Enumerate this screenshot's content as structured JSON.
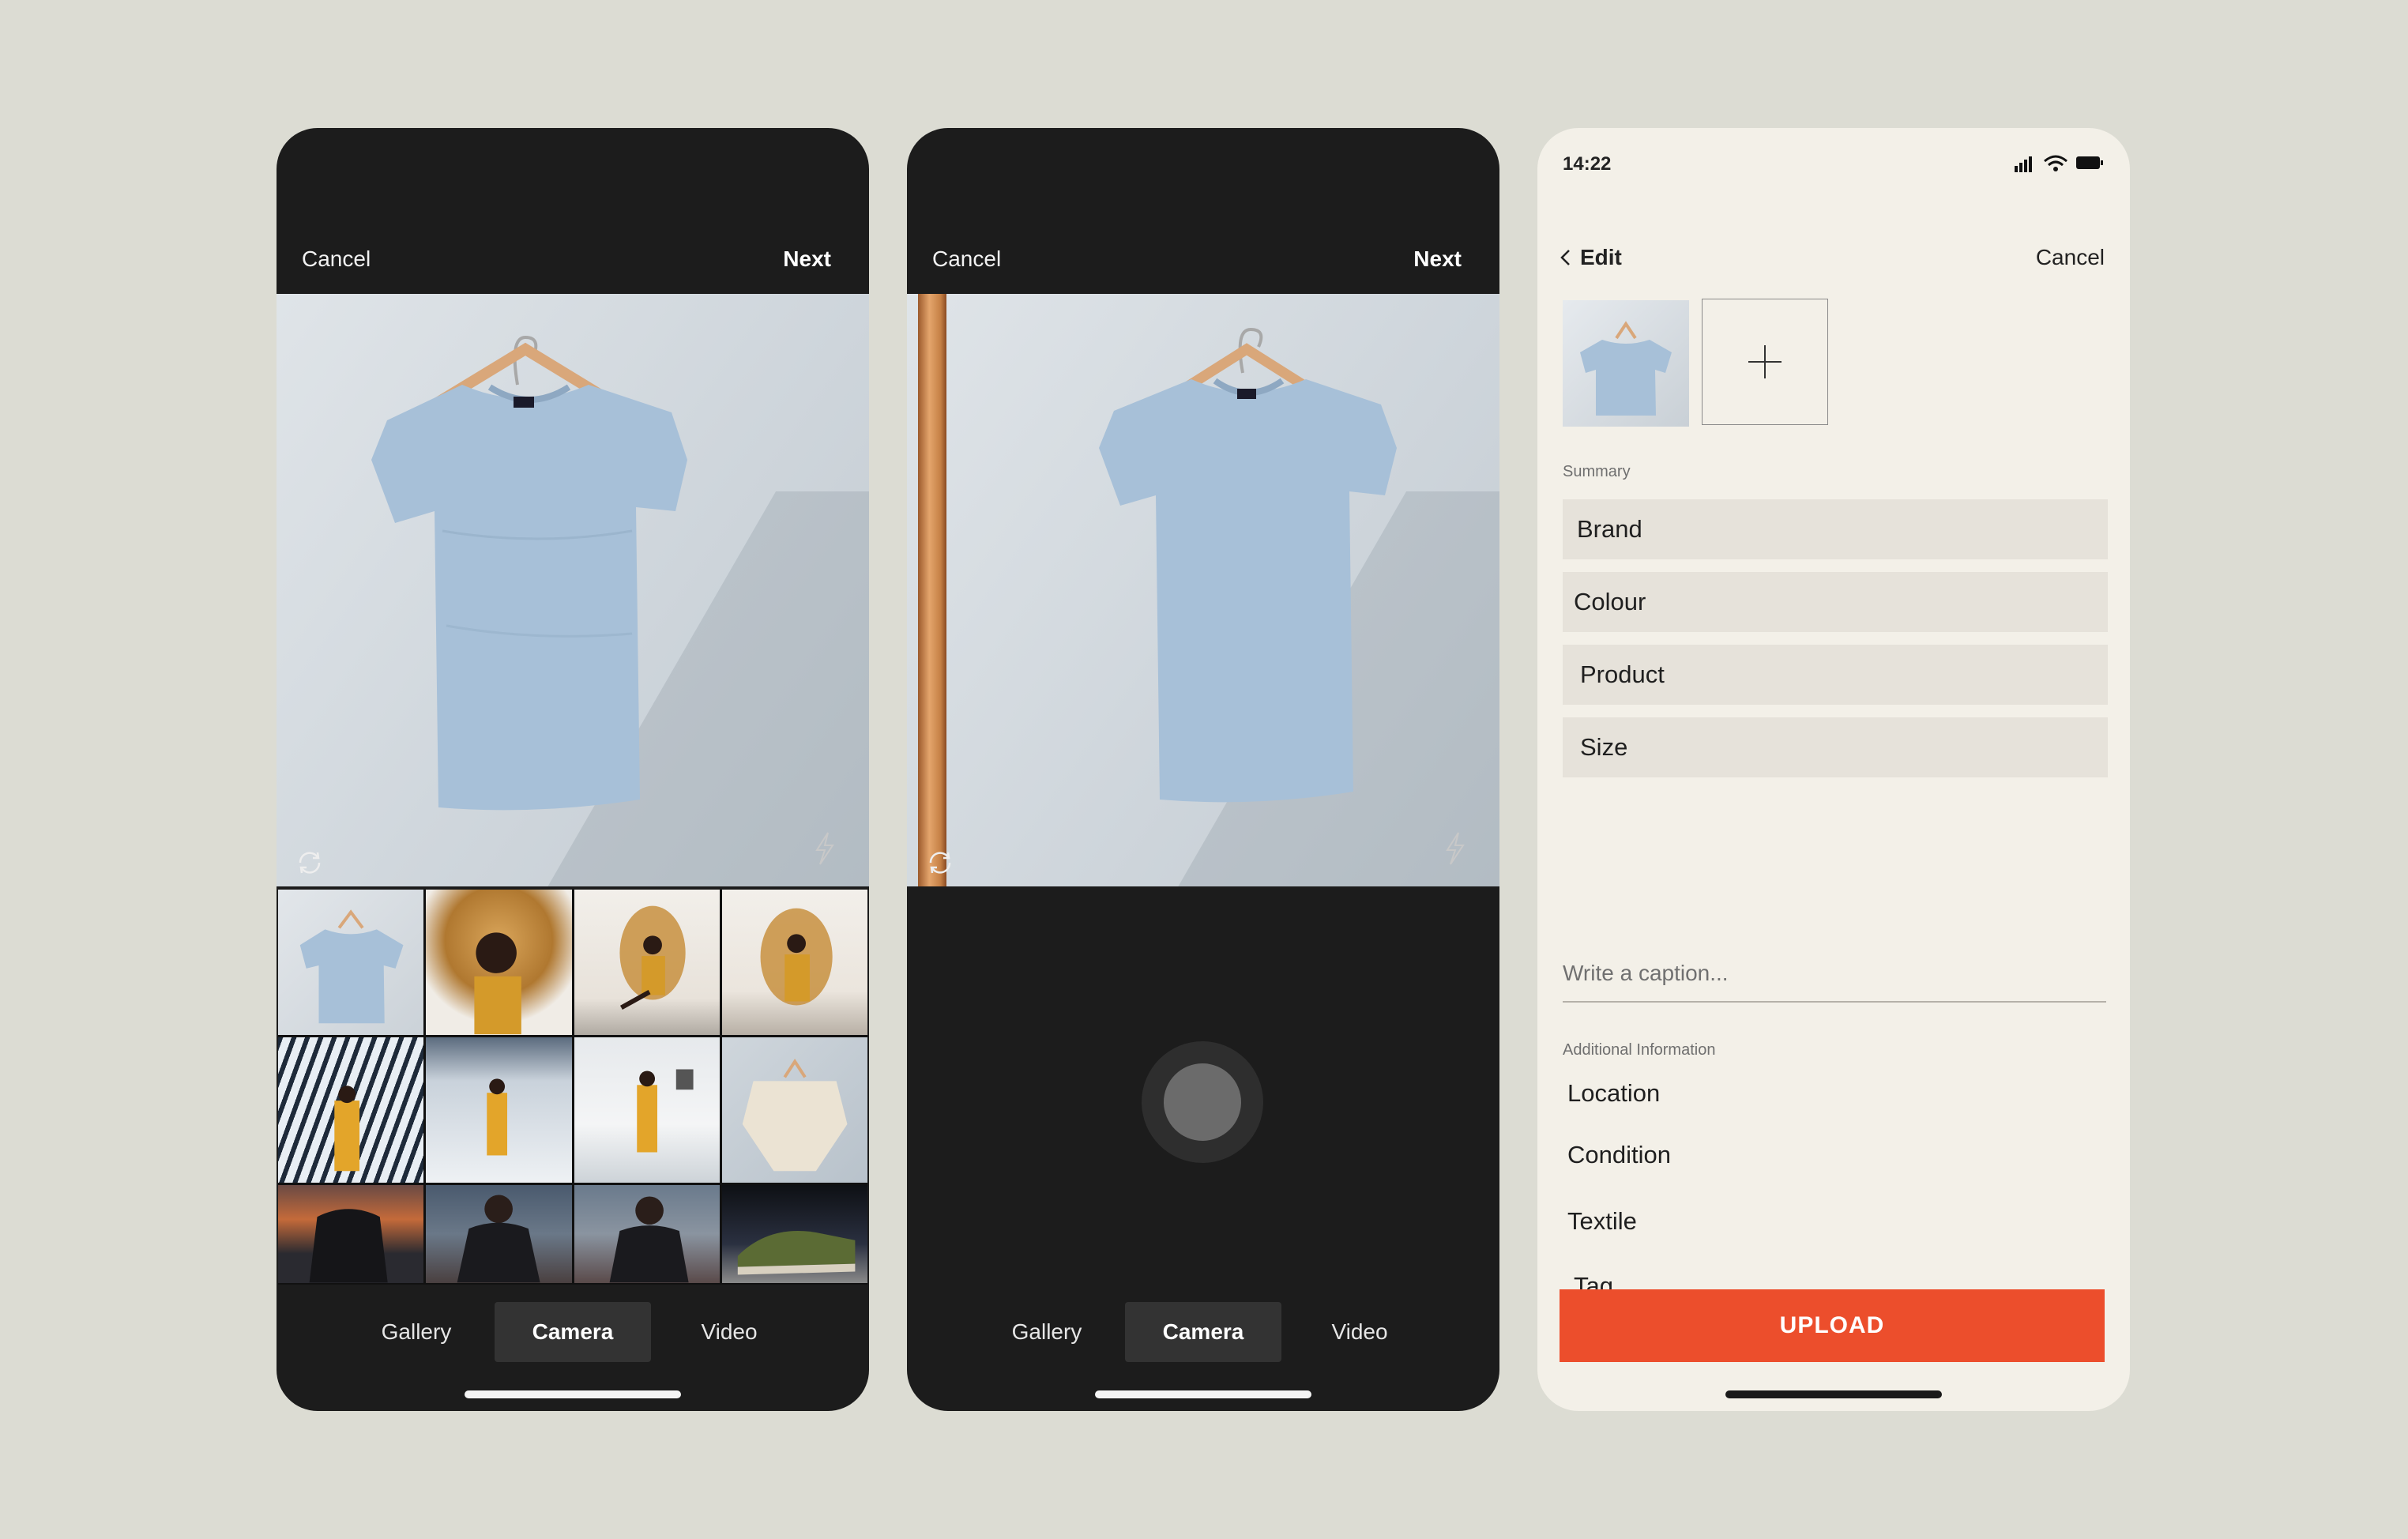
{
  "screens": {
    "gallery_picker": {
      "cancel_label": "Cancel",
      "next_label": "Next",
      "tabs": [
        "Gallery",
        "Camera",
        "Video"
      ],
      "active_tab": "Camera",
      "thumbnails": [
        "t-shirt on hanger",
        "woman in wicker chair",
        "woman in wicker chair",
        "woman in wicker chair",
        "woman under arched canopy",
        "woman in yellow dress",
        "woman in yellow dress",
        "knit poncho on hanger",
        "man in dark jacket",
        "man in dark jacket",
        "man in dark jacket",
        "green boots"
      ]
    },
    "camera": {
      "cancel_label": "Cancel",
      "next_label": "Next",
      "tabs": [
        "Gallery",
        "Camera",
        "Video"
      ],
      "active_tab": "Camera"
    },
    "edit": {
      "status_time": "14:22",
      "back_label": "Edit",
      "cancel_label": "Cancel",
      "summary_label": "Summary",
      "fields": [
        "Brand",
        "Colour",
        "Product",
        "Size"
      ],
      "caption_placeholder": "Write a caption...",
      "additional_label": "Additional Information",
      "additional_items": [
        "Location",
        "Condition",
        "Textile",
        "Tag"
      ],
      "upload_label": "UPLOAD"
    }
  },
  "colors": {
    "background": "#dcdcd3",
    "dark_screen": "#1c1c1c",
    "light_screen": "#f3f0e8",
    "field_bg": "#e6e2da",
    "accent": "#ec4e2c"
  },
  "icons": [
    "rotate-camera-icon",
    "flash-icon",
    "chevron-left-icon",
    "plus-icon",
    "signal-icon",
    "wifi-icon",
    "battery-icon"
  ]
}
